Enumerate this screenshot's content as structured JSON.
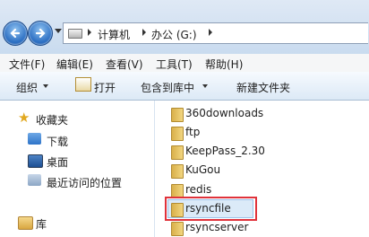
{
  "address": {
    "crumbs": [
      "计算机",
      "办公 (G:)"
    ]
  },
  "menubar": [
    "文件(F)",
    "编辑(E)",
    "查看(V)",
    "工具(T)",
    "帮助(H)"
  ],
  "toolbar": {
    "organize": "组织",
    "open": "打开",
    "include": "包含到库中",
    "new_folder": "新建文件夹"
  },
  "nav": {
    "favorites": "收藏夹",
    "downloads": "下载",
    "desktop": "桌面",
    "recent": "最近访问的位置",
    "libraries": "库"
  },
  "files": [
    "360downloads",
    "ftp",
    "KeepPass_2.30",
    "KuGou",
    "redis",
    "rsyncfile",
    "rsyncserver"
  ],
  "selected": "rsyncfile",
  "colors": {
    "highlight": "#e0323b",
    "selection": "#dbeaf8"
  }
}
